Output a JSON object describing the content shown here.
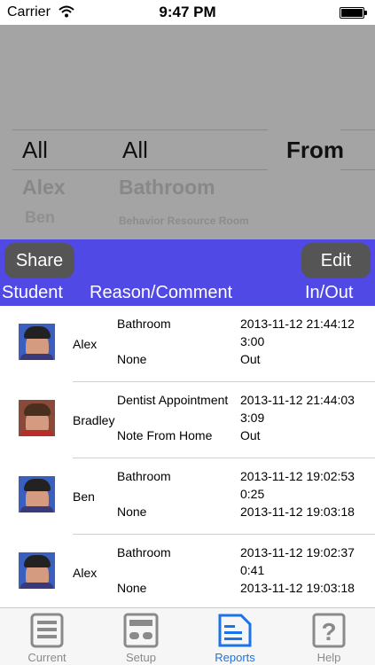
{
  "status_bar": {
    "carrier": "Carrier",
    "time": "9:47 PM"
  },
  "picker": {
    "col1": {
      "selected": "All",
      "next": "Alex",
      "next2": "Ben"
    },
    "col2": {
      "selected": "All",
      "next": "Bathroom",
      "next2": "Behavior Resource Room"
    },
    "col3": {
      "selected": "From"
    }
  },
  "toolbar": {
    "share_label": "Share",
    "edit_label": "Edit",
    "headers": {
      "student": "Student",
      "reason": "Reason/Comment",
      "inout": "In/Out"
    }
  },
  "rows": [
    {
      "name": "Alex",
      "reason": "Bathroom",
      "comment": "None",
      "time_in": "2013-11-12 21:44:12",
      "duration": "3:00",
      "out": "Out",
      "avatar": "cap"
    },
    {
      "name": "Bradley",
      "reason": "Dentist Appointment",
      "comment": "Note From Home",
      "time_in": "2013-11-12 21:44:03",
      "duration": "3:09",
      "out": "Out",
      "avatar": "hair"
    },
    {
      "name": "Ben",
      "reason": "Bathroom",
      "comment": "None",
      "time_in": "2013-11-12 19:02:53",
      "duration": "0:25",
      "out": "2013-11-12 19:03:18",
      "avatar": "cap"
    },
    {
      "name": "Alex",
      "reason": "Bathroom",
      "comment": "None",
      "time_in": "2013-11-12 19:02:37",
      "duration": "0:41",
      "out": "2013-11-12 19:03:18",
      "avatar": "cap"
    }
  ],
  "tabbar": {
    "tabs": [
      {
        "label": "Current",
        "icon": "list-icon",
        "active": false
      },
      {
        "label": "Setup",
        "icon": "setup-icon",
        "active": false
      },
      {
        "label": "Reports",
        "icon": "reports-icon",
        "active": true
      },
      {
        "label": "Help",
        "icon": "help-icon",
        "active": false
      }
    ]
  },
  "colors": {
    "toolbar": "#5049e6",
    "active_tab": "#1a73e8",
    "inactive_tab": "#8a8a8a",
    "picker_bg": "#a4a4a4"
  }
}
